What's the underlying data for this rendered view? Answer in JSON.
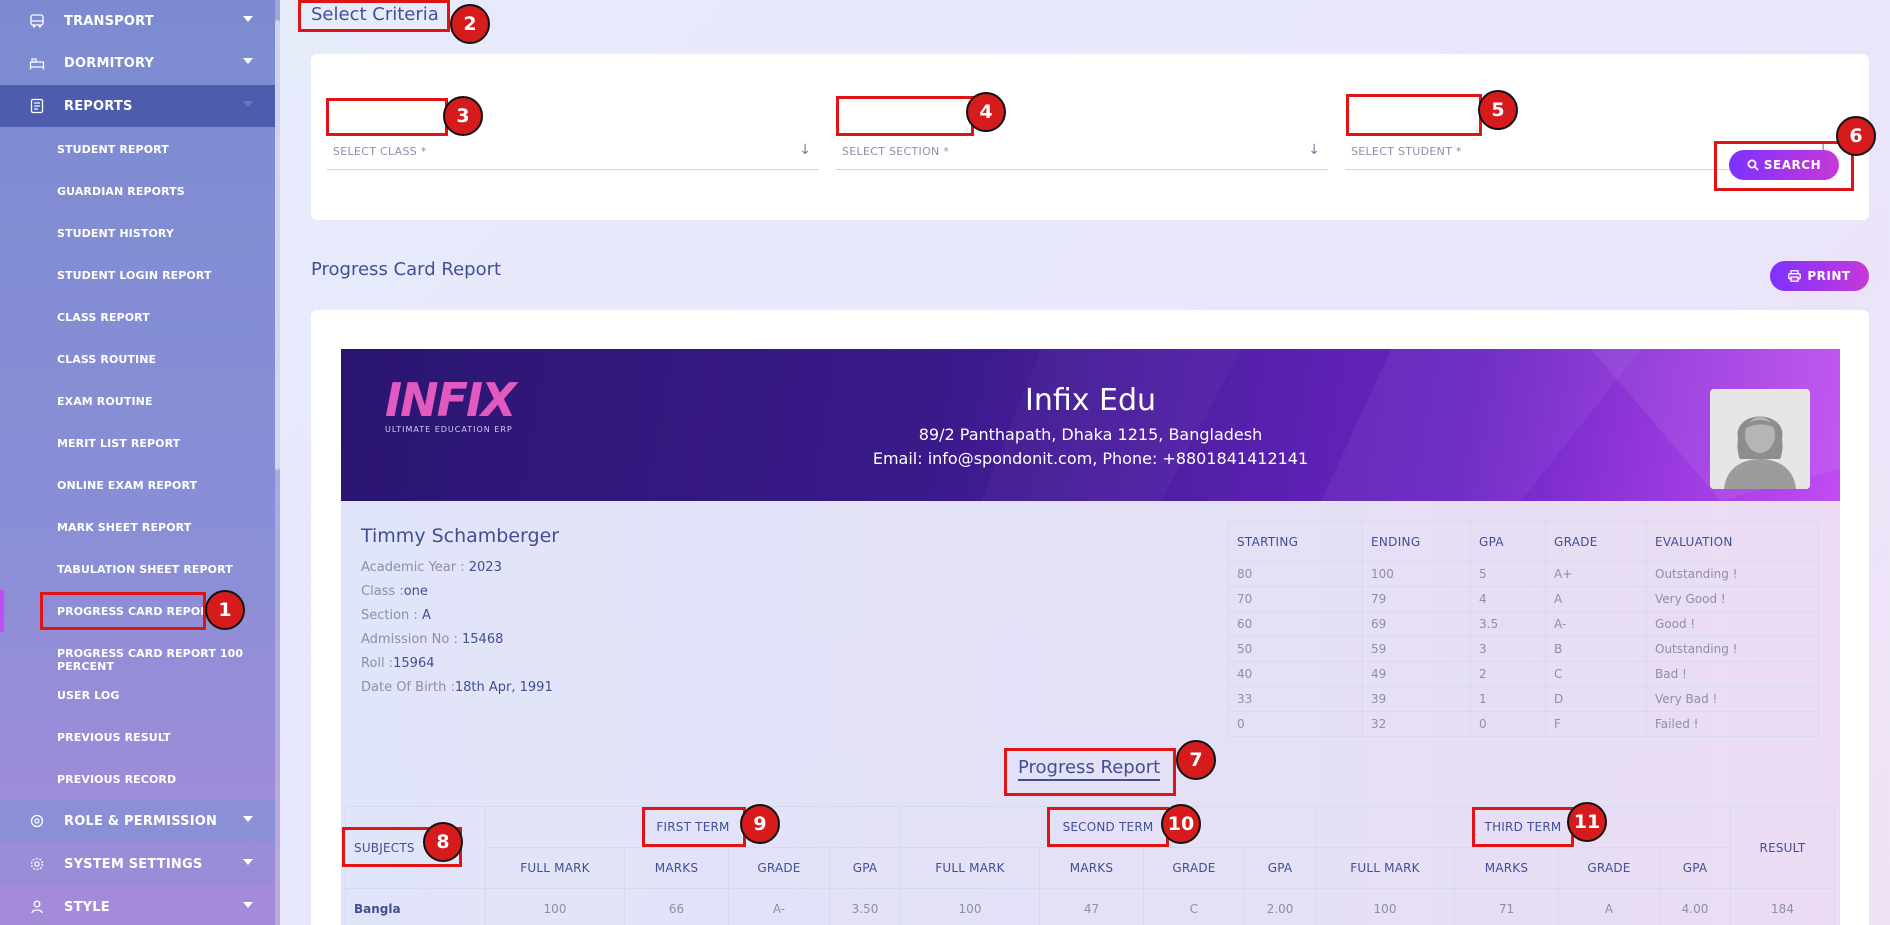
{
  "sidebar": {
    "top_items": [
      {
        "label": "TRANSPORT",
        "icon": "bus-icon"
      },
      {
        "label": "DORMITORY",
        "icon": "bed-icon"
      },
      {
        "label": "REPORTS",
        "icon": "report-icon"
      }
    ],
    "report_items": [
      "STUDENT REPORT",
      "GUARDIAN REPORTS",
      "STUDENT HISTORY",
      "STUDENT LOGIN REPORT",
      "CLASS REPORT",
      "CLASS ROUTINE",
      "EXAM ROUTINE",
      "MERIT LIST REPORT",
      "ONLINE EXAM REPORT",
      "MARK SHEET REPORT",
      "TABULATION SHEET REPORT",
      "PROGRESS CARD REPORT",
      "PROGRESS CARD REPORT 100 PERCENT",
      "USER LOG",
      "PREVIOUS RESULT",
      "PREVIOUS RECORD"
    ],
    "bottom_items": [
      {
        "label": "ROLE & PERMISSION",
        "icon": "role-icon"
      },
      {
        "label": "SYSTEM SETTINGS",
        "icon": "settings-icon"
      },
      {
        "label": "STYLE",
        "icon": "style-icon"
      }
    ]
  },
  "criteria": {
    "title": "Select Criteria",
    "class_placeholder": "SELECT CLASS *",
    "section_placeholder": "SELECT SECTION *",
    "student_placeholder": "SELECT STUDENT *",
    "search_label": "SEARCH"
  },
  "report": {
    "title": "Progress Card Report",
    "print_label": "PRINT",
    "logo_text": "INFIX",
    "logo_tagline": "ULTIMATE EDUCATION ERP",
    "school_name": "Infix Edu",
    "address": "89/2 Panthapath, Dhaka 1215, Bangladesh",
    "contact": "Email: info@spondonit.com, Phone: +8801841412141"
  },
  "student": {
    "name": "Timmy Schamberger",
    "academic_year_label": "Academic Year : ",
    "academic_year": "2023",
    "class_label": "Class :",
    "class": "one",
    "section_label": "Section : ",
    "section": "A",
    "admission_label": "Admission No : ",
    "admission": "15468",
    "roll_label": "Roll :",
    "roll": "15964",
    "dob_label": "Date Of Birth :",
    "dob": "18th Apr, 1991"
  },
  "grade_table": {
    "headers": [
      "STARTING",
      "ENDING",
      "GPA",
      "GRADE",
      "EVALUATION"
    ],
    "rows": [
      [
        "80",
        "100",
        "5",
        "A+",
        "Outstanding !"
      ],
      [
        "70",
        "79",
        "4",
        "A",
        "Very Good !"
      ],
      [
        "60",
        "69",
        "3.5",
        "A-",
        "Good !"
      ],
      [
        "50",
        "59",
        "3",
        "B",
        "Outstanding !"
      ],
      [
        "40",
        "49",
        "2",
        "C",
        "Bad !"
      ],
      [
        "33",
        "39",
        "1",
        "D",
        "Very Bad !"
      ],
      [
        "0",
        "32",
        "0",
        "F",
        "Failed !"
      ]
    ]
  },
  "progress": {
    "title": "Progress Report",
    "subjects_label": "SUBJECTS",
    "terms": [
      "FIRST TERM",
      "SECOND TERM",
      "THIRD TERM"
    ],
    "result_label": "RESULT",
    "sub_headers": [
      "FULL MARK",
      "MARKS",
      "GRADE",
      "GPA"
    ],
    "rows": [
      {
        "subject": "Bangla",
        "cells": [
          "100",
          "66",
          "A-",
          "3.50",
          "100",
          "47",
          "C",
          "2.00",
          "100",
          "71",
          "A",
          "4.00"
        ],
        "result": "184"
      }
    ]
  },
  "annotations": [
    "1",
    "2",
    "3",
    "4",
    "5",
    "6",
    "7",
    "8",
    "9",
    "10",
    "11"
  ]
}
